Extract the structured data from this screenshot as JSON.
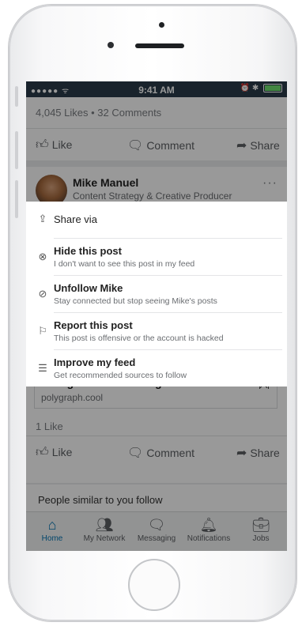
{
  "status_bar": {
    "signal": "●●●●● ᯤ",
    "time": "9:41 AM",
    "right_icons": "⏰ ✱"
  },
  "post_top": {
    "counts": "4,045 Likes • 32 Comments",
    "actions": {
      "like": "Like",
      "comment": "Comment",
      "share": "Share"
    }
  },
  "author": {
    "name": "Mike Manuel",
    "title": "Content Strategy & Creative Producer",
    "more": "···"
  },
  "menu": {
    "share": "Share via",
    "items": [
      {
        "title": "Hide this post",
        "subtitle": "I don't want to see this post in my feed",
        "icon": "hide-x-icon"
      },
      {
        "title": "Unfollow Mike",
        "subtitle": "Stay connected but stop seeing Mike's posts",
        "icon": "unfollow-icon"
      },
      {
        "title": "Report this post",
        "subtitle": "This post is offensive or the account is hacked",
        "icon": "flag-icon"
      },
      {
        "title": "Improve my feed",
        "subtitle": "Get recommended sources to follow",
        "icon": "sliders-icon"
      }
    ]
  },
  "shared_link": {
    "title": "Living Life After College",
    "url": "polygraph.cool"
  },
  "post_bottom": {
    "counts": "1 Like",
    "actions": {
      "like": "Like",
      "comment": "Comment",
      "share": "Share"
    }
  },
  "similar": "People similar to you follow",
  "nav": {
    "home": "Home",
    "network": "My Network",
    "messaging": "Messaging",
    "notifications": "Notifications",
    "jobs": "Jobs"
  },
  "colors": {
    "accent": "#0073b1",
    "status_bar": "#2a3b4a",
    "battery": "#6ee06e"
  }
}
